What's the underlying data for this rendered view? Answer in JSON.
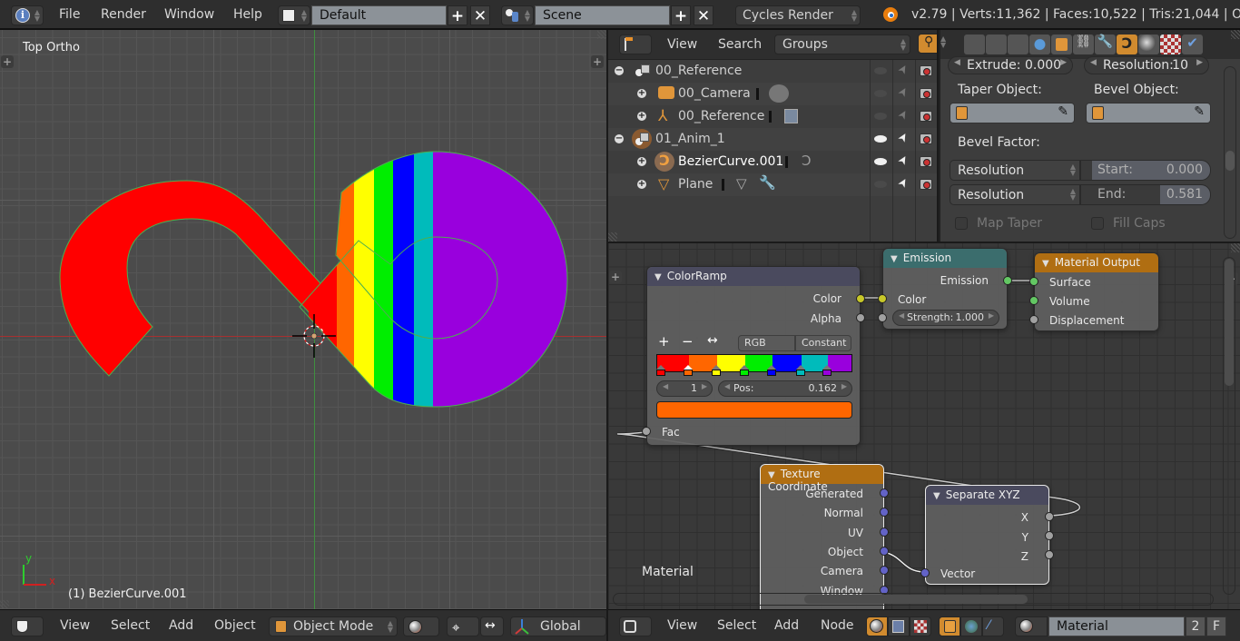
{
  "topbar": {
    "menus": [
      "File",
      "Render",
      "Window",
      "Help"
    ],
    "layout": "Default",
    "scene": "Scene",
    "render_engine": "Cycles Render",
    "stats": "v2.79 | Verts:11,362 | Faces:10,522 | Tris:21,044 | Object"
  },
  "viewport": {
    "view_label": "Top Ortho",
    "object_label": "(1) BezierCurve.001",
    "axis_x": "x",
    "axis_y": "y",
    "rainbow_colors": [
      "#ff0000",
      "#ff6600",
      "#ffff00",
      "#00ee00",
      "#0000ff",
      "#00bbbb",
      "#9900dd"
    ],
    "header": {
      "menus": [
        "View",
        "Select",
        "Add",
        "Object"
      ],
      "mode": "Object Mode",
      "orientation": "Global"
    }
  },
  "outliner": {
    "header": {
      "menus": [
        "View",
        "Search"
      ],
      "display_mode": "Groups"
    },
    "rows": [
      {
        "name": "00_Reference",
        "type": "group",
        "expanded": true,
        "visible": false
      },
      {
        "name": "00_Camera",
        "type": "camera",
        "visible": false
      },
      {
        "name": "00_Reference",
        "type": "empty",
        "visible": false
      },
      {
        "name": "01_Anim_1",
        "type": "group",
        "expanded": true,
        "visible": true
      },
      {
        "name": "BezierCurve.001",
        "type": "curve",
        "visible": true,
        "active": true
      },
      {
        "name": "Plane",
        "type": "mesh",
        "visible": false
      }
    ]
  },
  "properties": {
    "extrude_label": "Extrude:",
    "extrude_value": "0.000",
    "resolution_label": "Resolution:",
    "resolution_value": "10",
    "taper_object_label": "Taper Object:",
    "bevel_object_label": "Bevel Object:",
    "bevel_factor_label": "Bevel Factor:",
    "bevel_start_mode": "Resolution",
    "bevel_end_mode": "Resolution",
    "start_label": "Start:",
    "start_value": "0.000",
    "start_fraction": 0.0,
    "end_label": "End:",
    "end_value": "0.581",
    "end_fraction": 0.581,
    "map_taper_label": "Map Taper",
    "fill_caps_label": "Fill Caps"
  },
  "node_editor": {
    "material_label": "Material",
    "colorramp": {
      "title": "ColorRamp",
      "out_color": "Color",
      "out_alpha": "Alpha",
      "color_mode": "RGB",
      "interpolation": "Constant",
      "active_index": "1",
      "pos_label": "Pos:",
      "pos_value": "0.162",
      "active_color": "#ff6600",
      "in_fac": "Fac",
      "stops": [
        {
          "pos": 0.0,
          "color": "#ff0000"
        },
        {
          "pos": 0.162,
          "color": "#ff6600"
        },
        {
          "pos": 0.305,
          "color": "#ffff00"
        },
        {
          "pos": 0.45,
          "color": "#00ee00"
        },
        {
          "pos": 0.59,
          "color": "#0000ff"
        },
        {
          "pos": 0.735,
          "color": "#00bbbb"
        },
        {
          "pos": 0.87,
          "color": "#9900dd"
        }
      ]
    },
    "emission": {
      "title": "Emission",
      "out_emission": "Emission",
      "in_color": "Color",
      "strength_label": "Strength:",
      "strength_value": "1.000"
    },
    "material_output": {
      "title": "Material Output",
      "surface": "Surface",
      "volume": "Volume",
      "displacement": "Displacement"
    },
    "texture_coordinate": {
      "title": "Texture Coordinate",
      "outputs": [
        "Generated",
        "Normal",
        "UV",
        "Object",
        "Camera",
        "Window"
      ]
    },
    "separate_xyz": {
      "title": "Separate XYZ",
      "outputs": [
        "X",
        "Y",
        "Z"
      ],
      "in_vector": "Vector"
    },
    "header": {
      "menus": [
        "View",
        "Select",
        "Add",
        "Node"
      ],
      "material_name": "Material",
      "users": "2",
      "fake_user": "F"
    }
  }
}
